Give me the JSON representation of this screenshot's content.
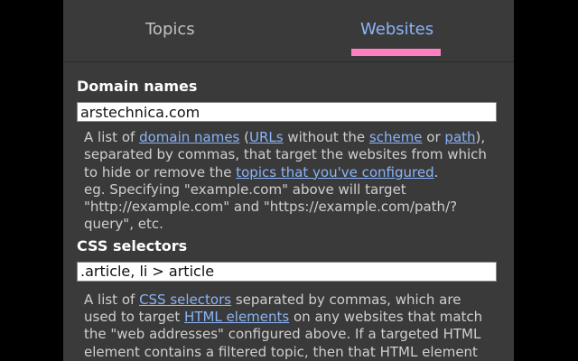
{
  "tabs": {
    "topics": "Topics",
    "websites": "Websites"
  },
  "domains": {
    "label": "Domain names",
    "value": "arstechnica.com",
    "desc": {
      "t1": "A list of ",
      "l1": "domain names",
      "t2": " (",
      "l2": "URLs",
      "t3": " without the ",
      "l3": "scheme",
      "t4": " or ",
      "l4": "path",
      "t5": "),",
      "t6": "separated by commas, that target the websites from which",
      "t7": "to hide or remove the ",
      "l5": "topics that you've configured",
      "t8": ".",
      "t9": "eg. Specifying \"example.com\" above will target",
      "t10": "\"http://example.com\" and \"https://example.com/path/?",
      "t11": "query\", etc."
    }
  },
  "css": {
    "label": "CSS selectors",
    "value": ".article, li > article",
    "desc": {
      "t1": "A list of ",
      "l1": "CSS selectors",
      "t2": " separated by commas, which are",
      "t3": "used to target ",
      "l2": "HTML elements",
      "t4": " on any websites that match",
      "t5": "the \"web addresses\" configured above. If a targeted HTML",
      "t6": "element contains a filtered topic, then that HTML element"
    }
  }
}
